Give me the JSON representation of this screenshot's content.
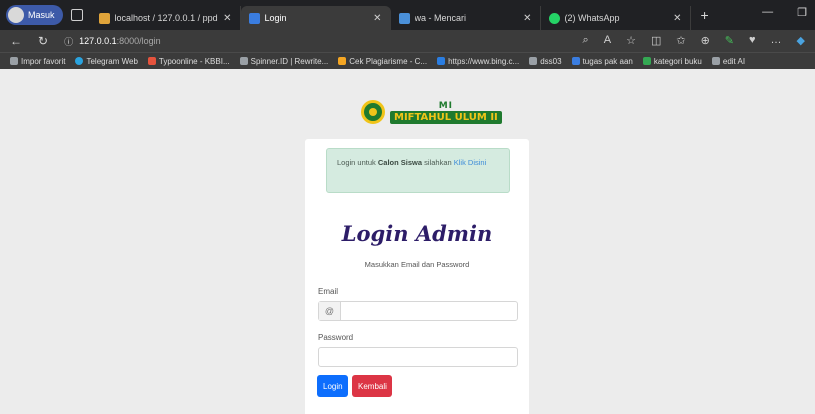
{
  "browser": {
    "profile_label": "Masuk",
    "tabs": [
      {
        "title": "localhost / 127.0.0.1 / ppdb | ph",
        "favicon_color": "#e0a43a",
        "active": false
      },
      {
        "title": "Login",
        "favicon_color": "#3a7de0",
        "active": true
      },
      {
        "title": "wa - Mencari",
        "favicon_color": "#4a90d9",
        "active": false
      },
      {
        "title": "(2) WhatsApp",
        "favicon_color": "#25d366",
        "active": false
      }
    ],
    "new_tab_symbol": "+",
    "address": {
      "host": "127.0.0.1",
      "path": ":8000/login"
    },
    "bookmarks": [
      {
        "label": "Impor favorit",
        "color": "#9aa0a6"
      },
      {
        "label": "Telegram Web",
        "color": "#2aa3df"
      },
      {
        "label": "Typoonline - KBBI...",
        "color": "#e5533d"
      },
      {
        "label": "Spinner.ID | Rewrite...",
        "color": "#9aa0a6"
      },
      {
        "label": "Cek Plagiarisme - C...",
        "color": "#f5a623"
      },
      {
        "label": "https://www.bing.c...",
        "color": "#2a7de1"
      },
      {
        "label": "dss03",
        "color": "#9aa0a6"
      },
      {
        "label": "tugas pak aan",
        "color": "#3a7de0"
      },
      {
        "label": "kategori buku",
        "color": "#34a853"
      },
      {
        "label": "edit AI",
        "color": "#9aa0a6"
      }
    ]
  },
  "page": {
    "logo": {
      "line1": "MI",
      "line2": "MIFTAHUL ULUM II"
    },
    "alert": {
      "prefix": "Login untuk ",
      "bold": "Calon Siswa",
      "middle": " silahkan ",
      "link": "Klik Disini"
    },
    "title": "Login Admin",
    "subtitle": "Masukkan Email dan Password",
    "email_label": "Email",
    "email_addon": "@",
    "email_value": "",
    "password_label": "Password",
    "password_value": "",
    "login_button": "Login",
    "back_button": "Kembali"
  }
}
